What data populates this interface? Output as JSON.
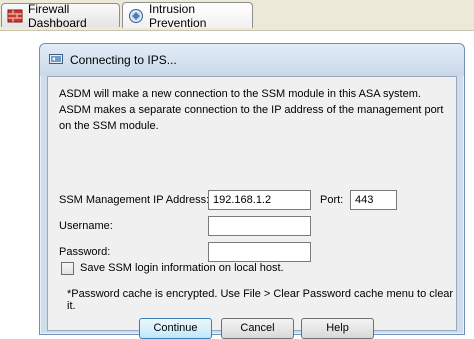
{
  "tabs": [
    {
      "label": "Firewall Dashboard",
      "icon": "firewall-icon"
    },
    {
      "label": "Intrusion Prevention",
      "icon": "ips-icon"
    }
  ],
  "dialog": {
    "title": "Connecting to IPS...",
    "description": "ASDM will make a new connection to the SSM module in this ASA system. ASDM makes a separate connection to the IP address of the management port on the SSM module.",
    "ip_label": "SSM Management IP Address:",
    "ip_value": "192.168.1.2",
    "port_label": "Port:",
    "port_value": "443",
    "username_label": "Username:",
    "username_value": "",
    "password_label": "Password:",
    "password_value": "",
    "save_label": "Save SSM login information on local host.",
    "save_checked": false,
    "note": "*Password cache is encrypted. Use File > Clear Password cache menu to clear it.",
    "buttons": {
      "continue": "Continue",
      "cancel": "Cancel",
      "help": "Help"
    }
  }
}
